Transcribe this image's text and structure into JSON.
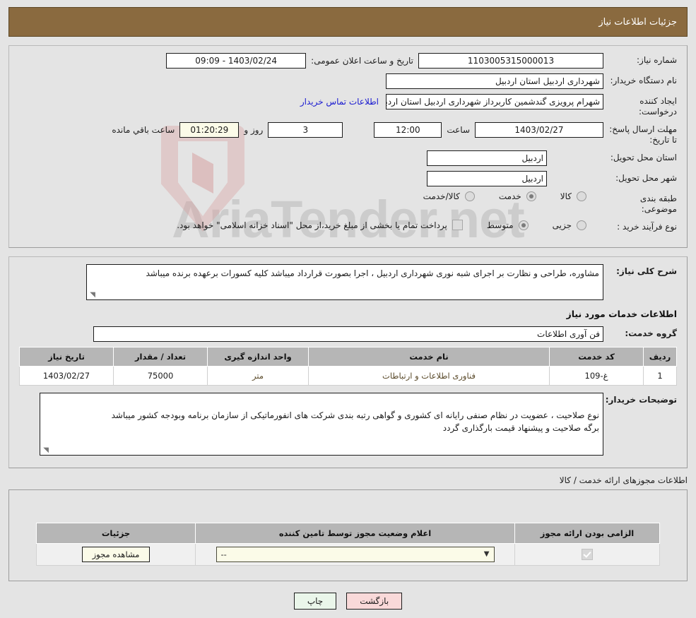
{
  "header": {
    "title": "جزئیات اطلاعات نیاز"
  },
  "fields": {
    "need_number_label": "شماره نیاز:",
    "need_number_value": "1103005315000013",
    "publish_label": "تاریخ و ساعت اعلان عمومی:",
    "publish_value": "1403/02/24 - 09:09",
    "buyer_org_label": "نام دستگاه خریدار:",
    "buyer_org_value": "شهرداری اردبیل استان اردبیل",
    "creator_label": "ایجاد کننده درخواست:",
    "creator_value": "شهرام پرویزی گندشمین کاربرداز شهرداری اردبیل استان اردبیل",
    "contact_link": "اطلاعات تماس خریدار",
    "deadline_label": "مهلت ارسال پاسخ: تا تاریخ:",
    "deadline_date": "1403/02/27",
    "hour_label": "ساعت",
    "deadline_time": "12:00",
    "days_value": "3",
    "days_label": "روز و",
    "countdown_value": "01:20:29",
    "countdown_label": "ساعت باقي مانده",
    "province_label": "استان محل تحویل:",
    "province_value": "اردبیل",
    "city_label": "شهر محل تحویل:",
    "city_value": "اردبیل",
    "category_label": "طبقه بندی موضوعی:",
    "process_label": "نوع فرآیند خرید :",
    "treasury_note": "پرداخت تمام یا بخشی از مبلغ خرید،از محل \"اسناد خزانه اسلامی\" خواهد بود."
  },
  "category_options": [
    {
      "label": "کالا",
      "selected": false
    },
    {
      "label": "خدمت",
      "selected": true
    },
    {
      "label": "کالا/خدمت",
      "selected": false
    }
  ],
  "process_options": [
    {
      "label": "جزیی",
      "selected": false
    },
    {
      "label": "متوسط",
      "selected": true
    }
  ],
  "description": {
    "label": "شرح کلی نیاز:",
    "text": "مشاوره، طراحی و نظارت بر اجرای شبه نوری شهرداری اردبیل ، اجرا بصورت قرارداد میباشد کلیه کسورات برعهده برنده میباشد"
  },
  "services": {
    "section_title": "اطلاعات خدمات مورد نیاز",
    "group_label": "گروه خدمت:",
    "group_value": "فن آوری اطلاعات",
    "columns": [
      "ردیف",
      "کد خدمت",
      "نام خدمت",
      "واحد اندازه گیری",
      "تعداد / مقدار",
      "تاریخ نیاز"
    ],
    "rows": [
      {
        "radif": "1",
        "code": "غ-109",
        "name": "فناوری اطلاعات و ارتباطات",
        "unit": "متر",
        "quantity": "75000",
        "date": "1403/02/27"
      }
    ]
  },
  "buyer_notes": {
    "label": "توضیحات خریدار:",
    "text": "نوع صلاحیت ، عضویت در نظام صنفی رایانه ای کشوری و گواهی رتبه بندی شرکت های انفورماتیکی از سازمان برنامه وبودجه کشور میباشد\nبرگه صلاحیت و پیشنهاد قیمت بارگذاری گردد"
  },
  "permits": {
    "caption": "اطلاعات مجوزهای ارائه خدمت / کالا",
    "columns": [
      "الزامی بودن ارائه مجوز",
      "اعلام وضعیت مجوز توسط تامین کننده",
      "جزئیات"
    ],
    "rows": [
      {
        "required": true,
        "status_value": "--",
        "details_button": "مشاهده مجوز"
      }
    ]
  },
  "footer": {
    "back_label": "بازگشت",
    "print_label": "چاپ"
  }
}
